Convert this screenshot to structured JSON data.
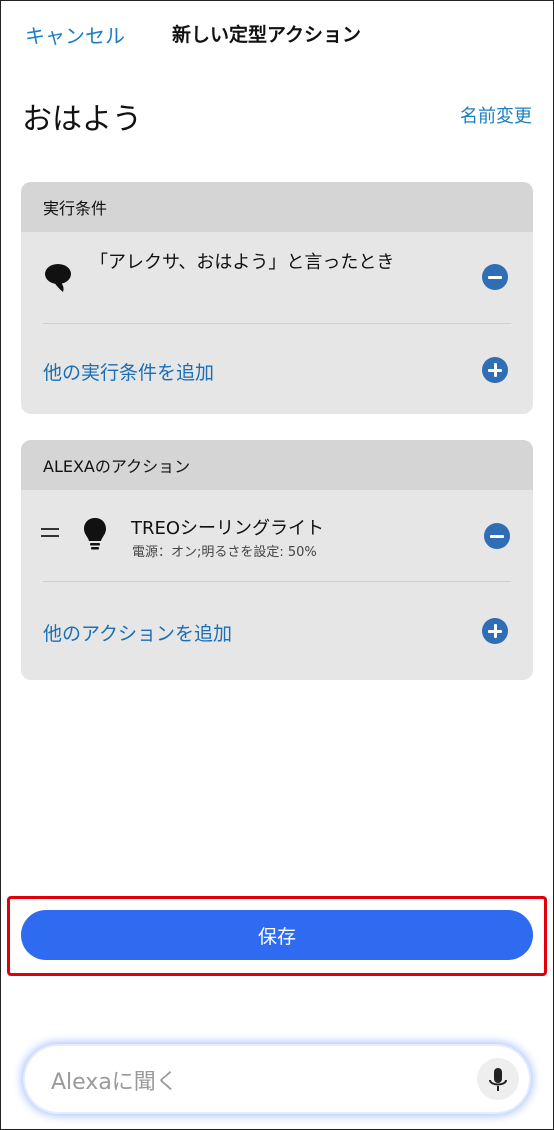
{
  "header": {
    "cancel_label": "キャンセル",
    "title": "新しい定型アクション"
  },
  "routine": {
    "name": "おはよう",
    "rename_label": "名前変更"
  },
  "trigger_section": {
    "heading": "実行条件",
    "trigger": {
      "icon": "speech-bubble-icon",
      "text": "「アレクサ、おはよう」と言ったとき"
    },
    "add_label": "他の実行条件を追加"
  },
  "action_section": {
    "heading": "ALEXAのアクション",
    "actions": [
      {
        "icon": "lightbulb-icon",
        "title": "TREOシーリングライト",
        "detail": "電源：オン;明るさを設定: 50%"
      }
    ],
    "add_label": "他のアクションを追加"
  },
  "save_label": "保存",
  "ask_bar": {
    "placeholder": "Alexaに聞く",
    "icon": "microphone-icon"
  },
  "colors": {
    "link": "#1b7fc4",
    "primary_button": "#2f6bf0",
    "icon_button": "#2f6db5",
    "highlight": "#e0000b"
  }
}
